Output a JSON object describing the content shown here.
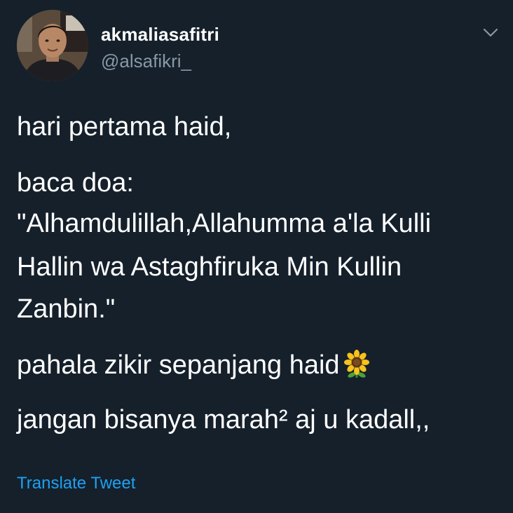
{
  "user": {
    "display_name": "akmaliasafitri",
    "handle": "@alsafikri_",
    "avatar": "profile-photo"
  },
  "tweet": {
    "lines": [
      "hari pertama haid,",
      "baca doa:",
      "\"Alhamdulillah,Allahumma a'la Kulli",
      "Hallin wa Astaghfiruka Min Kullin",
      "Zanbin.\"",
      "pahala zikir sepanjang haid",
      "jangan bisanya marah² aj u kadall,,"
    ],
    "emoji": "sunflower"
  },
  "actions": {
    "translate_label": "Translate Tweet",
    "menu_icon": "chevron-down-icon"
  },
  "colors": {
    "background": "#15202b",
    "text": "#ffffff",
    "secondary_text": "#8899a6",
    "link": "#1da1f2"
  }
}
